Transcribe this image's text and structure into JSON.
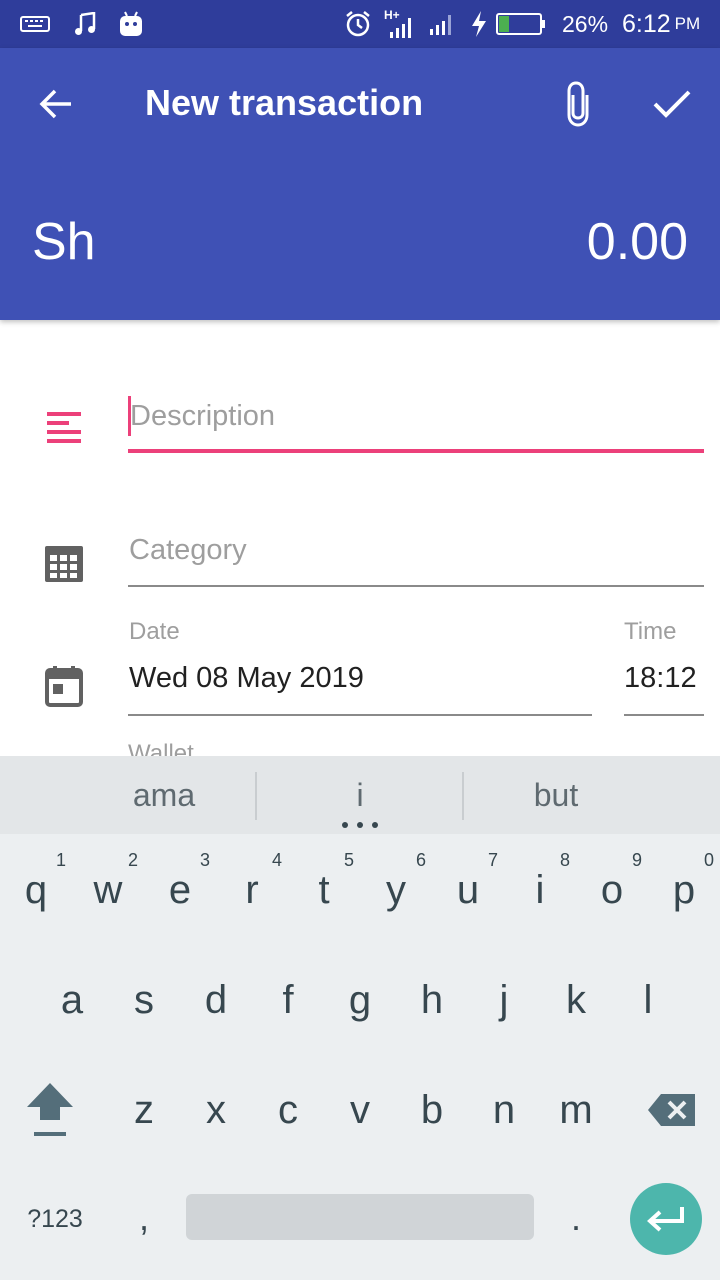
{
  "status_bar": {
    "battery_percent": "26%",
    "battery_level": 0.26,
    "time": "6:12",
    "ampm": "PM",
    "network": "H+",
    "icons": [
      "keyboard-icon",
      "music-note-icon",
      "android-icon",
      "alarm-icon",
      "signal-icon",
      "signal-icon",
      "charging-bolt-icon",
      "battery-icon"
    ]
  },
  "app_bar": {
    "title": "New transaction",
    "currency": "Sh",
    "amount": "0.00",
    "icons": [
      "back-arrow-icon",
      "attach-icon",
      "check-icon"
    ],
    "color": "#3f51b5"
  },
  "form": {
    "description_placeholder": "Description",
    "category_placeholder": "Category",
    "date_label": "Date",
    "date_value": "Wed 08 May 2019",
    "time_label": "Time",
    "time_value": "18:12",
    "next_label": "Wallet",
    "accent_color": "#ec407a",
    "icons": [
      "description-icon",
      "category-grid-icon",
      "calendar-icon"
    ]
  },
  "keyboard": {
    "suggestions": [
      "ama",
      "i",
      "but"
    ],
    "row1": [
      {
        "letter": "q",
        "hint": "1"
      },
      {
        "letter": "w",
        "hint": "2"
      },
      {
        "letter": "e",
        "hint": "3"
      },
      {
        "letter": "r",
        "hint": "4"
      },
      {
        "letter": "t",
        "hint": "5"
      },
      {
        "letter": "y",
        "hint": "6"
      },
      {
        "letter": "u",
        "hint": "7"
      },
      {
        "letter": "i",
        "hint": "8"
      },
      {
        "letter": "o",
        "hint": "9"
      },
      {
        "letter": "p",
        "hint": "0"
      }
    ],
    "row2": [
      "a",
      "s",
      "d",
      "f",
      "g",
      "h",
      "j",
      "k",
      "l"
    ],
    "row3": [
      "z",
      "x",
      "c",
      "v",
      "b",
      "n",
      "m"
    ],
    "symbols_label": "?123",
    "comma": ",",
    "period": ".",
    "icons": [
      "shift-icon",
      "backspace-icon",
      "enter-icon"
    ],
    "enter_color": "#4db6ac"
  }
}
